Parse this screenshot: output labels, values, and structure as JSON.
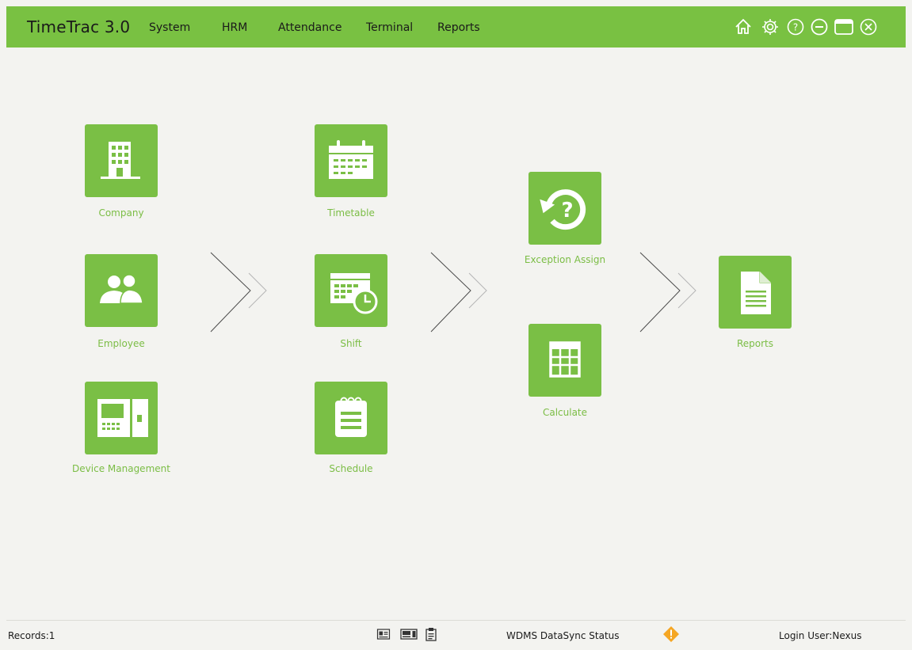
{
  "app": {
    "title": "TimeTrac 3.0",
    "menu": [
      "System",
      "HRM",
      "Attendance",
      "Terminal",
      "Reports"
    ],
    "window_controls": [
      "home-icon",
      "settings-icon",
      "help-icon",
      "minimize-icon",
      "maximize-icon",
      "close-icon"
    ]
  },
  "theme": {
    "accent": "#79c142",
    "tile": "#7abf45",
    "label": "#7bbd45",
    "background": "#f3f3f0",
    "warning": "#f5a623"
  },
  "modules": {
    "company": {
      "label": "Company",
      "icon": "building-icon"
    },
    "employee": {
      "label": "Employee",
      "icon": "users-icon"
    },
    "device": {
      "label": "Device Management",
      "icon": "terminal-device-icon"
    },
    "timetable": {
      "label": "Timetable",
      "icon": "calendar-icon"
    },
    "shift": {
      "label": "Shift",
      "icon": "calendar-clock-icon"
    },
    "schedule": {
      "label": "Schedule",
      "icon": "notepad-icon"
    },
    "exception": {
      "label": "Exception Assign",
      "icon": "history-question-icon"
    },
    "calculate": {
      "label": "Calculate",
      "icon": "table-grid-icon"
    },
    "reports": {
      "label": "Reports",
      "icon": "document-icon"
    }
  },
  "status": {
    "records": "Records:1",
    "icons": [
      "id-card-icon",
      "device-icon",
      "clipboard-icon"
    ],
    "sync": "WDMS DataSync Status",
    "sync_icon": "warning-diamond-icon",
    "user": "Login User:Nexus"
  }
}
